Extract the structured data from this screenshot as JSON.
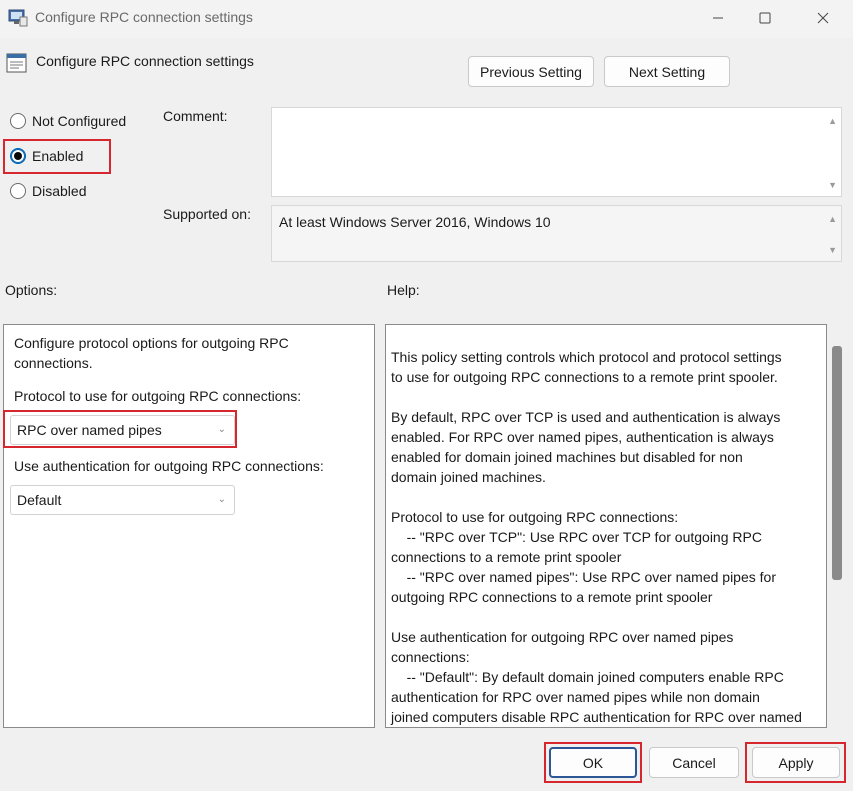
{
  "window": {
    "title": "Configure RPC connection settings",
    "minimize_icon": "minimize-icon",
    "maximize_icon": "maximize-icon",
    "close_icon": "close-icon"
  },
  "header": {
    "title": "Configure RPC connection settings",
    "previous_label": "Previous Setting",
    "next_label": "Next Setting"
  },
  "state": {
    "options": [
      {
        "label": "Not Configured",
        "checked": false
      },
      {
        "label": "Enabled",
        "checked": true
      },
      {
        "label": "Disabled",
        "checked": false
      }
    ]
  },
  "comment": {
    "label": "Comment:",
    "value": ""
  },
  "supported": {
    "label": "Supported on:",
    "value": "At least Windows Server 2016, Windows 10"
  },
  "options_section": {
    "label": "Options:",
    "intro_line1": "Configure protocol options for outgoing RPC",
    "intro_line2": "connections.",
    "protocol_label": "Protocol to use for outgoing RPC connections:",
    "protocol_value": "RPC over named pipes",
    "auth_label": "Use authentication for outgoing RPC connections:",
    "auth_value": "Default"
  },
  "help_section": {
    "label": "Help:",
    "paragraphs": [
      "This policy setting controls which protocol and protocol settings\nto use for outgoing RPC connections to a remote print spooler.",
      "By default, RPC over TCP is used and authentication is always\nenabled. For RPC over named pipes, authentication is always\nenabled for domain joined machines but disabled for non\ndomain joined machines.",
      "Protocol to use for outgoing RPC connections:\n    -- \"RPC over TCP\": Use RPC over TCP for outgoing RPC\nconnections to a remote print spooler\n    -- \"RPC over named pipes\": Use RPC over named pipes for\noutgoing RPC connections to a remote print spooler",
      "Use authentication for outgoing RPC over named pipes\nconnections:\n    -- \"Default\": By default domain joined computers enable RPC\nauthentication for RPC over named pipes while non domain\njoined computers disable RPC authentication for RPC over named"
    ]
  },
  "footer": {
    "ok_label": "OK",
    "cancel_label": "Cancel",
    "apply_label": "Apply"
  },
  "colors": {
    "highlight": "#d6272f",
    "background": "#f0f0f0"
  }
}
